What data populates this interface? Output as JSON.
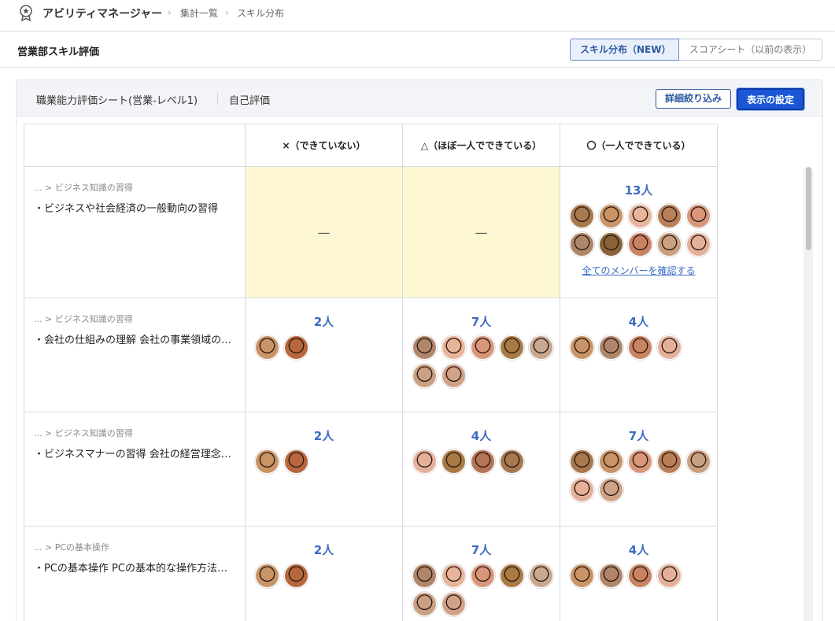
{
  "header": {
    "app_name": "アビリティマネージャー",
    "breadcrumbs": [
      "集計一覧",
      "スキル分布"
    ]
  },
  "subheader": {
    "title": "営業部スキル評価",
    "view_active": "スキル分布（NEW）",
    "view_inactive": "スコアシート（以前の表示）"
  },
  "panel": {
    "sheet_name": "職業能力評価シート(営業-レベル1)",
    "mode": "自己評価",
    "filter_label": "詳細絞り込み",
    "settings_label": "表示の設定"
  },
  "table": {
    "headers": [
      "×（できていない）",
      "△（ほぼ一人でできている）",
      "〇（一人でできている）"
    ],
    "empty_mark": "—",
    "see_all_label": "全てのメンバーを確認する",
    "rows": [
      {
        "path": "... > ビジネス知識の習得",
        "title": "・ビジネスや社会経済の一般動向の習得",
        "cells": [
          {
            "count": "",
            "avatars": []
          },
          {
            "count": "",
            "avatars": []
          },
          {
            "count": "13人",
            "avatars": [
              "#a8784e",
              "#c99466",
              "#e8b49a",
              "#b98058",
              "#d9967a",
              "#b0866a",
              "#8a6238",
              "#c98262",
              "#caa082",
              "#e5b09a"
            ],
            "see_all": true
          }
        ]
      },
      {
        "path": "... > ビジネス知識の習得",
        "title": "・会社の仕組みの理解 会社の事業領域の把握",
        "cells": [
          {
            "count": "2人",
            "avatars": [
              "#c99466",
              "#b8663e"
            ]
          },
          {
            "count": "7人",
            "avatars": [
              "#b0866a",
              "#e8b49a",
              "#d9967a",
              "#a87a44",
              "#c8a890",
              "#caa082",
              "#d0a288"
            ]
          },
          {
            "count": "4人",
            "avatars": [
              "#c99466",
              "#b0866a",
              "#c98262",
              "#e5b09a"
            ]
          }
        ]
      },
      {
        "path": "... > ビジネス知識の習得",
        "title": "・ビジネスマナーの習得 会社の経営理念の理解",
        "cells": [
          {
            "count": "2人",
            "avatars": [
              "#c99466",
              "#b8663e"
            ]
          },
          {
            "count": "4人",
            "avatars": [
              "#e5b09a",
              "#a87a44",
              "#b57456",
              "#a8784e"
            ]
          },
          {
            "count": "7人",
            "avatars": [
              "#a8784e",
              "#c99466",
              "#d9967a",
              "#b98058",
              "#caa082",
              "#e5b09a",
              "#d0a288"
            ]
          }
        ]
      },
      {
        "path": "... > PCの基本操作",
        "title": "・PCの基本操作 PCの基本的な操作方法の習得",
        "cells": [
          {
            "count": "2人",
            "avatars": [
              "#c99466",
              "#b8663e"
            ]
          },
          {
            "count": "7人",
            "avatars": [
              "#b0866a",
              "#e8b49a",
              "#d9967a",
              "#a87a44",
              "#c8a890",
              "#caa082",
              "#d0a288"
            ]
          },
          {
            "count": "4人",
            "avatars": [
              "#c99466",
              "#b0866a",
              "#c98262",
              "#e5b09a"
            ]
          }
        ]
      }
    ]
  }
}
